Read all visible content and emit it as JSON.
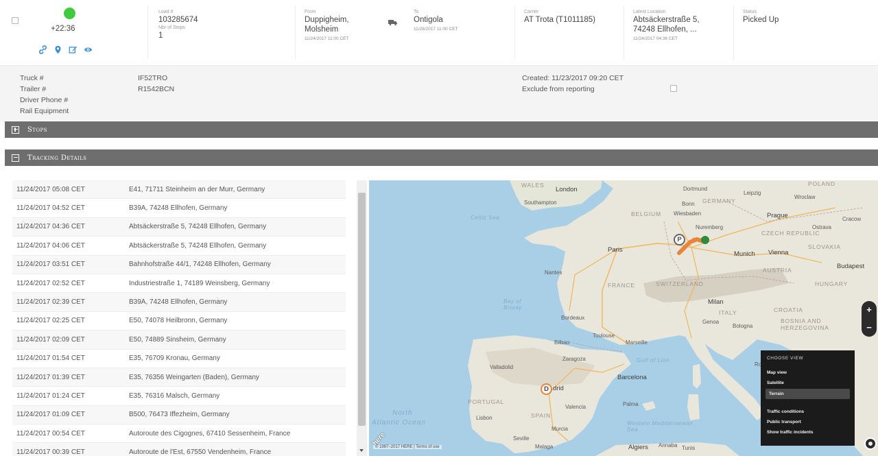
{
  "shipment": {
    "eta": "+22:36",
    "load_label": "Load #",
    "load_number": "103285674",
    "stops_label": "Nbr of Stops",
    "stops_count": "1",
    "from_label": "From",
    "from_line1": "Duppigheim,",
    "from_line2": "Molsheim",
    "from_date": "11/24/2017 11:00 CET",
    "to_label": "To",
    "to_value": "Ontigola",
    "to_date": "11/28/2017 11:00 CET",
    "carrier_label": "Carrier",
    "carrier_value": "AT Trota (T1011185)",
    "latest_label": "Latest Location",
    "latest_line1": "Abtsäckerstraße 5,",
    "latest_line2": "74248 Ellhofen, ...",
    "latest_date": "11/24/2017 04:36 CET",
    "status_label": "Status",
    "status_value": "Picked Up",
    "status_color": "#3fca3f",
    "icons": [
      "link-icon",
      "location-pin-icon",
      "edit-icon",
      "eye-icon"
    ]
  },
  "details": {
    "truck_label": "Truck #",
    "trailer_label": "Trailer #",
    "driver_phone_label": "Driver Phone #",
    "rail_label": "Rail Equipment",
    "truck_value": "IF52TRO",
    "trailer_value": "R1542BCN",
    "created": "Created: 11/23/2017 09:20 CET",
    "exclude_label": "Exclude from reporting"
  },
  "sections": {
    "stops": "Stops",
    "tracking": "Tracking Details"
  },
  "tracking": [
    {
      "time": "11/24/2017 05:08 CET",
      "location": "E41, 71711 Steinheim an der Murr, Germany"
    },
    {
      "time": "11/24/2017 04:52 CET",
      "location": "B39A, 74248 Ellhofen, Germany"
    },
    {
      "time": "11/24/2017 04:36 CET",
      "location": "Abtsäckerstraße 5, 74248 Ellhofen, Germany"
    },
    {
      "time": "11/24/2017 04:06 CET",
      "location": "Abtsäckerstraße 5, 74248 Ellhofen, Germany"
    },
    {
      "time": "11/24/2017 03:51 CET",
      "location": "Bahnhofstraße 44/1, 74248 Ellhofen, Germany"
    },
    {
      "time": "11/24/2017 02:52 CET",
      "location": "Industriestraße 1, 74189 Weinsberg, Germany"
    },
    {
      "time": "11/24/2017 02:39 CET",
      "location": "B39A, 74248 Ellhofen, Germany"
    },
    {
      "time": "11/24/2017 02:25 CET",
      "location": "E50, 74078 Heilbronn, Germany"
    },
    {
      "time": "11/24/2017 02:09 CET",
      "location": "E50, 74889 Sinsheim, Germany"
    },
    {
      "time": "11/24/2017 01:54 CET",
      "location": "E35, 76709 Kronau, Germany"
    },
    {
      "time": "11/24/2017 01:39 CET",
      "location": "E35, 76356 Weingarten (Baden), Germany"
    },
    {
      "time": "11/24/2017 01:24 CET",
      "location": "E35, 76316 Malsch, Germany"
    },
    {
      "time": "11/24/2017 01:09 CET",
      "location": "B500, 76473 Iffezheim, Germany"
    },
    {
      "time": "11/24/2017 00:54 CET",
      "location": "Autoroute des Cigognes, 67410 Sessenheim, France"
    },
    {
      "time": "11/24/2017 00:39 CET",
      "location": "Autoroute de l'Est, 67550 Vendenheim, France"
    }
  ],
  "map": {
    "cities": {
      "london": "London",
      "southampton": "Southampton",
      "paris": "Paris",
      "nantes": "Nantes",
      "bordeaux": "Bordeaux",
      "toulouse": "Toulouse",
      "marseille": "Marseille",
      "genoa": "Genoa",
      "milan": "Milan",
      "bologna": "Bologna",
      "munich": "Munich",
      "vienna": "Vienna",
      "prague": "Prague",
      "budapest": "Budapest",
      "leipzig": "Leipzig",
      "dortmund": "Dortmund",
      "wiesbaden": "Wiesbaden",
      "nuremberg": "Nuremberg",
      "wroclaw": "Wroclaw",
      "cracow": "Cracow",
      "zaragoza": "Zaragoza",
      "barcelona": "Barcelona",
      "valladolid": "Valladolid",
      "madrid": "drid",
      "valencia": "Valencia",
      "lisbon": "Lisbon",
      "seville": "Seville",
      "malaga": "Malaga",
      "murcia": "Murcia",
      "algiers": "Algiers",
      "annaba": "Annaba",
      "tunis": "Tunis",
      "palma": "Palma",
      "bilbao": "Bilbao",
      "ostrava": "Ostrava",
      "bonn": "Bonn",
      "rome": "Ro"
    },
    "countries": {
      "wales": "WALES",
      "germany": "GERMANY",
      "belgium": "BELGIUM",
      "czech": "CZECH REPUBLIC",
      "slovakia": "SLOVAKIA",
      "austria": "AUSTRIA",
      "hungary": "HUNGARY",
      "france": "FRANCE",
      "switzerland": "SWITZERLAND",
      "italy": "ITALY",
      "croatia": "CROATIA",
      "bosnia": "BOSNIA AND HERZEGOVINA",
      "portugal": "PORTUGAL",
      "spain": "SPAIN",
      "poland": "POLAND"
    },
    "seas": {
      "celtic": "Celtic Sea",
      "biscay": "Bay of Biscay",
      "lion": "Gulf of Lion",
      "ocean_north": "North",
      "ocean": "Atlantic Ocean",
      "mediterranean": "Western Mediterranean Sea"
    },
    "marker_origin": "P",
    "marker_dest": "D",
    "zoom_in": "+",
    "zoom_out": "−",
    "logo": "here",
    "copyright": "© 1987–2017 HERE | Terms of use",
    "choose_view": {
      "title": "CHOOSE VIEW",
      "items": [
        "Map view",
        "Satellite",
        "Terrain"
      ],
      "active": "Terrain",
      "overlays": [
        "Traffic conditions",
        "Public transport",
        "Show traffic incidents"
      ]
    },
    "colors": {
      "water": "#a9cfe6",
      "land": "#e9e6dc",
      "route": "#e8853a",
      "latest": "#2e8b3a"
    }
  }
}
